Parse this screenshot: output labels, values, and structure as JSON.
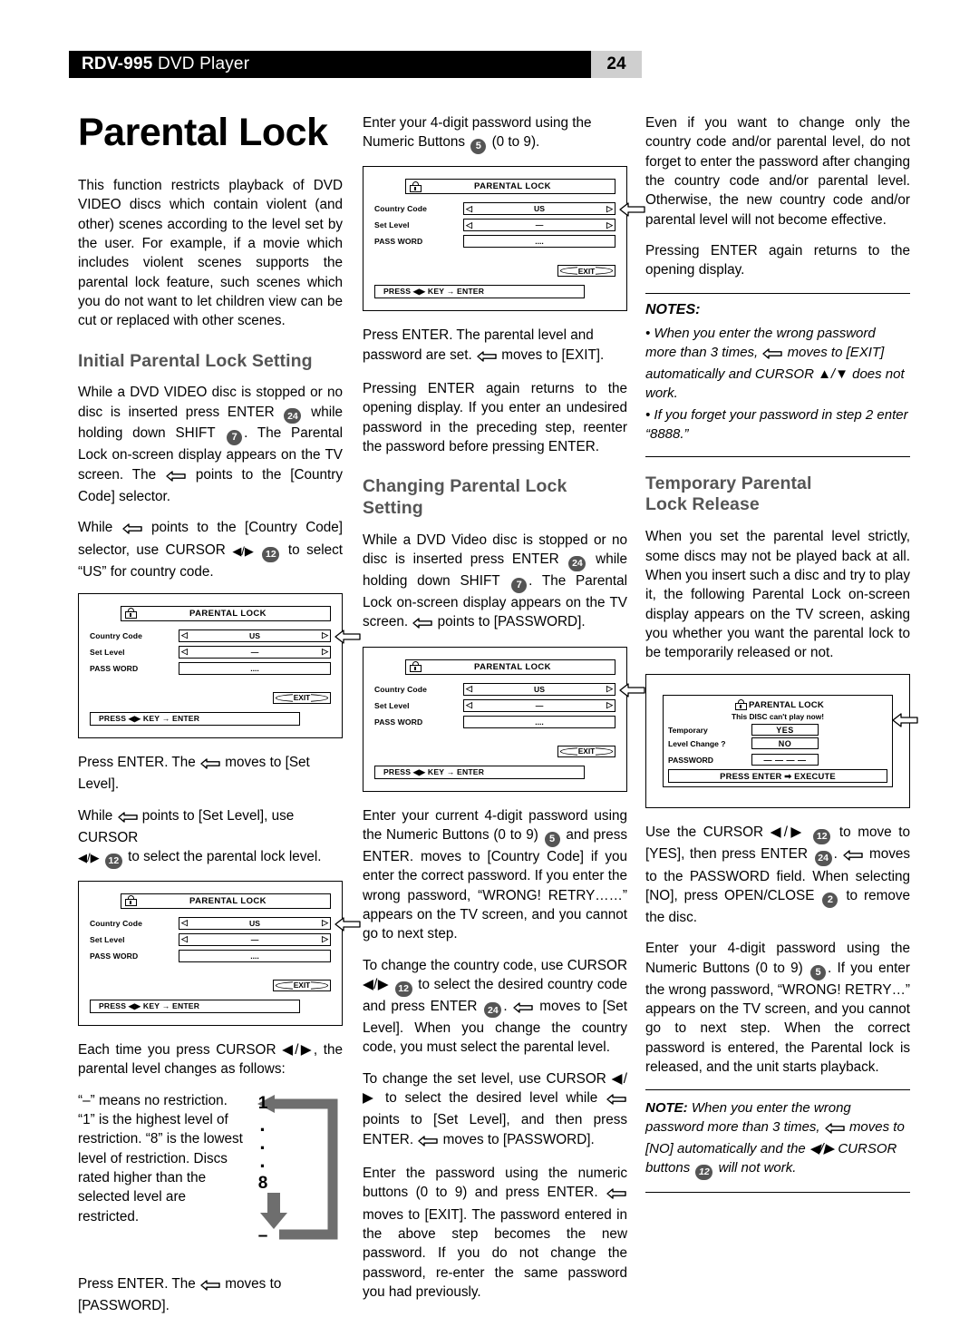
{
  "header": {
    "model": "RDV-995",
    "product": " DVD Player",
    "page_number": "24"
  },
  "title": "Parental Lock",
  "left_column": {
    "intro": "This function restricts playback of DVD VIDEO discs which contain violent (and other) scenes according to the level set by the user. For example, if a movie which includes violent scenes supports the parental lock feature, such scenes which you do not want to let children view can be cut or replaced with other scenes.",
    "heading_initial": "Initial Parental Lock Setting",
    "p1_a": "While a DVD VIDEO disc is stopped or no disc is inserted press ENTER",
    "p1_badge1": "24",
    "p1_b": "while holding down SHIFT",
    "p1_badge2": "7",
    "p1_c": ". The Parental Lock on-screen display appears on the TV screen. The",
    "p1_d": "points to the [Country Code] selector.",
    "p2_a": "While",
    "p2_b": "points to the [Country Code] selector, use CURSOR",
    "p2_badge": "12",
    "p2_c": "to select “US” for country code.",
    "p3_a": "Press ENTER. The",
    "p3_b": "moves to [Set Level].",
    "p4_a": "While",
    "p4_b": "points to [Set Level], use CURSOR",
    "p4_badge": "12",
    "p4_c": "to select the parental lock level.",
    "p5": "Each time you press CURSOR ◀/▶, the parental level changes as follows:",
    "p6": "“–” means no restriction. “1” is the highest level of restriction. “8” is the lowest level of restriction. Discs rated higher than the selected level are restricted.",
    "p7_a": "Press ENTER. The",
    "p7_b": "moves to [PASSWORD]."
  },
  "level_figure": {
    "top": "1",
    "dot1": "·",
    "dot2": "·",
    "dot3": "·",
    "bottom": "8",
    "end": "–"
  },
  "osd": {
    "title": "PARENTAL LOCK",
    "label_country": "Country Code",
    "label_level": "Set Level",
    "label_password": "PASS WORD",
    "value_country": "US",
    "value_level": "—",
    "value_password": "....",
    "caret_left": "◁",
    "caret_right": "▷",
    "exit": "EXIT",
    "footer": "PRESS ◀▶ KEY → ENTER"
  },
  "osd_temporary": {
    "title": "PARENTAL LOCK",
    "subtitle": "This DISC can't play now!",
    "label_temporary": "Temporary",
    "label_level_change": "Level Change ?",
    "label_password": "PASSWORD",
    "yes": "YES",
    "no": "NO",
    "password_value": "— — — —",
    "footer": "PRESS ENTER ➡ EXECUTE"
  },
  "mid_column": {
    "p1_a": "Enter your 4-digit password using the Numeric Buttons",
    "p1_badge": "5",
    "p1_b": "(0 to 9).",
    "p2_a": "Press ENTER. The parental level and password are set.",
    "p2_b": "moves to [EXIT].",
    "p3": "Pressing ENTER again returns to the opening display. If you enter an undesired password in the preceding step, reenter the password before pressing ENTER.",
    "heading_changing": "Changing Parental Lock Setting",
    "p4_a": "While a DVD Video disc is stopped or no disc is inserted press ENTER",
    "p4_badge1": "24",
    "p4_b": "while holding down SHIFT",
    "p4_badge2": "7",
    "p4_c": ". The Parental Lock on-screen display appears on the TV screen.",
    "p4_d": "points to [PASSWORD].",
    "p5_a": "Enter your current 4-digit password using the Numeric Buttons (0 to 9)",
    "p5_badge": "5",
    "p5_b": "and press ENTER. moves to [Country Code] if you enter the correct password. If you enter the wrong password, “WRONG! RETRY……” appears on the TV screen, and you cannot go to next step.",
    "p6_a": "To change the country code, use CURSOR ◀/▶",
    "p6_badge1": "12",
    "p6_b": "to select the desired country code and press ENTER",
    "p6_badge2": "24",
    "p6_c": ".",
    "p6_d": "moves to [Set Level]. When you change the country code, you must select the parental level.",
    "p7_a": "To change the set level, use CURSOR ◀/▶ to select the desired level while",
    "p7_b": "points to [Set Level], and then press ENTER.",
    "p7_c": "moves to [PASSWORD].",
    "p8_a": "Enter the password using the numeric buttons (0 to 9) and press ENTER.",
    "p8_b": "moves to [EXIT]. The password entered in the above step becomes the new password. If you do not change the password, re-enter the same password you had previously."
  },
  "right_column": {
    "p1": "Even if you want to change only the country code and/or parental level, do not forget to enter the password after changing the country code and/or parental level. Otherwise, the new country code and/or parental level will not become effective.",
    "p2": "Pressing ENTER again returns to the opening display.",
    "notes_heading": "NOTES:",
    "note1_a": "• When you enter the wrong password more than 3 times,",
    "note1_b": "moves to [EXIT] automatically and CURSOR ▲/▼ does not work.",
    "note2": "• If you forget your password in step 2 enter “8888.”",
    "heading_temporary_line1": "Temporary Parental",
    "heading_temporary_line2": "Lock Release",
    "p3": "When you set the parental level strictly, some discs may not be played back at all. When you insert such a disc and try to play it, the following Parental Lock on-screen display appears on the TV screen, asking you whether you want the parental lock to be temporarily released or not.",
    "p4_a": "Use the CURSOR ◀/▶",
    "p4_badge1": "12",
    "p4_b": "to move to [YES], then press ENTER",
    "p4_badge2": "24",
    "p4_c": ".",
    "p4_d": "moves to the PASSWORD field. When selecting [NO], press OPEN/CLOSE",
    "p4_badge3": "2",
    "p4_e": "to remove the disc.",
    "p5_a": "Enter your 4-digit password using the Numeric Buttons (0 to 9)",
    "p5_badge": "5",
    "p5_b": ". If you enter the wrong password, “WRONG! RETRY…” appears on the TV screen, and you cannot go to next step. When the correct password is entered, the Parental lock is released, and the unit starts playback.",
    "note_label": "NOTE:",
    "note_a": "When you enter the wrong password more than 3 times,",
    "note_b": "moves to [NO] automatically and the ◀/▶ CURSOR buttons",
    "note_badge": "12",
    "note_c": "will not work."
  }
}
